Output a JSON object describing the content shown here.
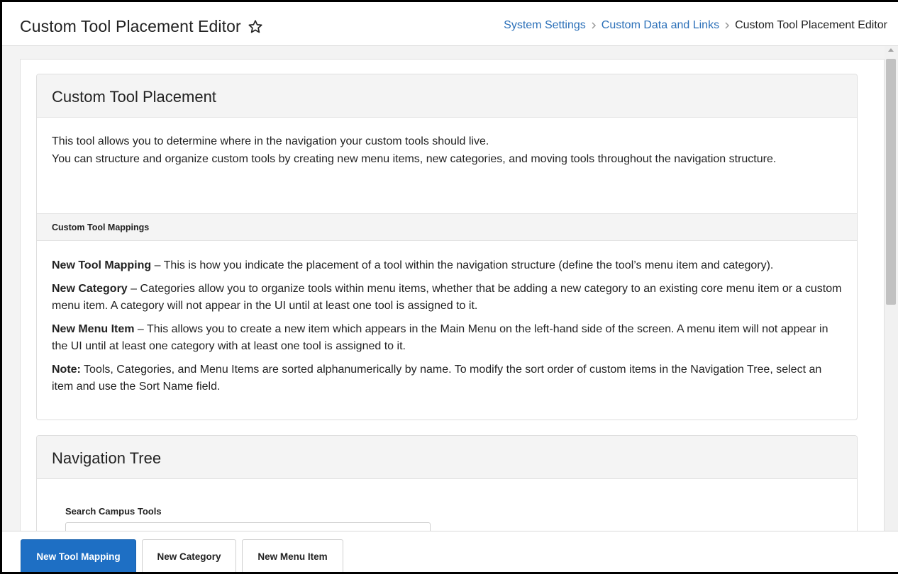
{
  "header": {
    "title": "Custom Tool Placement Editor",
    "breadcrumb": [
      {
        "label": "System Settings"
      },
      {
        "label": "Custom Data and Links"
      }
    ],
    "breadcrumb_current": "Custom Tool Placement Editor"
  },
  "placement_card": {
    "title": "Custom Tool Placement",
    "intro_line_1": "This tool allows you to determine where in the navigation your custom tools should live.",
    "intro_line_2": "You can structure and organize custom tools by creating new menu items, new categories, and moving tools throughout the navigation structure.",
    "mappings_heading": "Custom Tool Mappings",
    "definitions": [
      {
        "term": "New Tool Mapping",
        "text": " – This is how you indicate the placement of a tool within the navigation structure (define the tool’s menu item and category)."
      },
      {
        "term": "New Category",
        "text": " – Categories allow you to organize tools within menu items, whether that be adding a new category to an existing core menu item or a custom menu item. A category will not appear in the UI until at least one tool is assigned to it."
      },
      {
        "term": "New Menu Item",
        "text": " – This allows you to create a new item which appears in the Main Menu on the left-hand side of the screen. A menu item will not appear in the UI until at least one category with at least one tool is assigned to it."
      },
      {
        "term": "Note:",
        "text": " Tools, Categories, and Menu Items are sorted alphanumerically by name. To modify the sort order of custom items in the Navigation Tree, select an item and use the Sort Name field."
      }
    ]
  },
  "navigation_card": {
    "title": "Navigation Tree",
    "search_label": "Search Campus Tools",
    "search_placeholder": "Search Campus Tools",
    "search_value": ""
  },
  "footer": {
    "new_tool_mapping": "New Tool Mapping",
    "new_category": "New Category",
    "new_menu_item": "New Menu Item"
  },
  "colors": {
    "link": "#2a6fb8",
    "primary_button": "#1e6fc4"
  },
  "icons": {
    "favorite": "star-outline-icon",
    "breadcrumb_separator": "chevron-right-icon"
  }
}
